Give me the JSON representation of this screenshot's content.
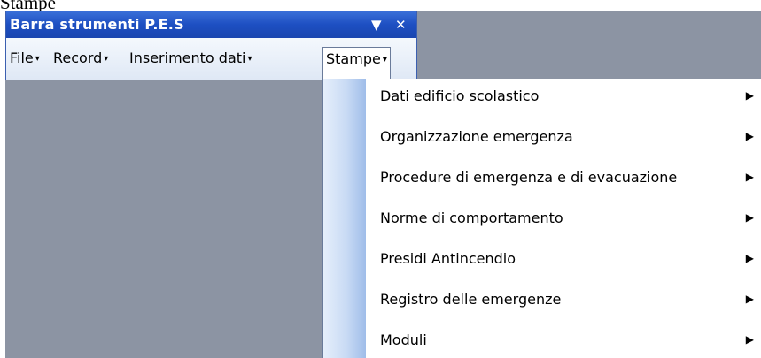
{
  "caption": "Stampe",
  "toolbar": {
    "title": "Barra strumenti P.E.S",
    "dropdown_icon": "▼",
    "close_icon": "✕"
  },
  "menu": [
    {
      "label": "File",
      "arrow": "▾"
    },
    {
      "label": "Record",
      "arrow": "▾"
    },
    {
      "label": "Inserimento dati",
      "arrow": "▾"
    },
    {
      "label": "Stampe",
      "arrow": "▾",
      "active": true
    }
  ],
  "dropdown": {
    "submenu_arrow": "▶",
    "items": [
      {
        "label": "Dati edificio scolastico"
      },
      {
        "label": "Organizzazione emergenza"
      },
      {
        "label": "Procedure di emergenza e di evacuazione"
      },
      {
        "label": "Norme di comportamento"
      },
      {
        "label": "Presidi Antincendio"
      },
      {
        "label": "Registro delle emergenze"
      },
      {
        "label": "Moduli"
      }
    ]
  },
  "colors": {
    "titlebar": "#1d4fc2",
    "workspace": "#8c94a3",
    "menu_background": "#dfe8f5",
    "dropdown_strip": "#c8daf4"
  }
}
